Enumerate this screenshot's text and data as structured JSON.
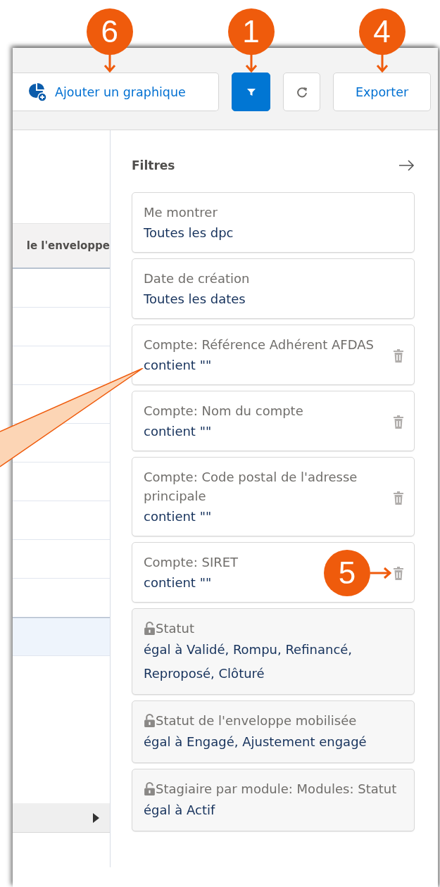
{
  "toolbar": {
    "buttons": [
      {
        "kind": "chart",
        "label": "Ajouter un graphique",
        "callout": "6"
      },
      {
        "kind": "filter",
        "selected": true,
        "callout": "1"
      },
      {
        "kind": "refresh"
      },
      {
        "kind": "text",
        "label": "Exporter",
        "callout": "4"
      }
    ]
  },
  "table": {
    "header": "le l'enveloppe",
    "rows": [
      {
        "selected": false
      },
      {
        "selected": false
      },
      {
        "selected": false
      },
      {
        "selected": false
      },
      {
        "selected": false
      },
      {
        "selected": false
      },
      {
        "selected": false
      },
      {
        "selected": false
      },
      {
        "selected": false
      },
      {
        "selected": true
      }
    ]
  },
  "filters": {
    "title": "Filtres",
    "items": [
      {
        "kind": "plain",
        "label": "Me montrer",
        "value": "Toutes les dpc"
      },
      {
        "kind": "plain",
        "label": "Date de création",
        "value": "Toutes les dates"
      },
      {
        "kind": "removable",
        "label": "Compte: Référence Adhérent AFDAS",
        "value": "contient \"\""
      },
      {
        "kind": "removable",
        "label": "Compte: Nom du compte",
        "value": "contient \"\""
      },
      {
        "kind": "removable",
        "label": "Compte: Code postal de l'adresse principale",
        "value": "contient \"\""
      },
      {
        "kind": "removable",
        "label": "Compte: SIRET",
        "value": "contient \"\"",
        "callout": "5"
      },
      {
        "kind": "locked",
        "label": "Statut",
        "value": "égal à Validé, Rompu, Refinancé, Reproposé, Clôturé"
      },
      {
        "kind": "locked",
        "label": "Statut de l'enveloppe mobilisée",
        "value": "égal à Engagé, Ajustement engagé"
      },
      {
        "kind": "locked",
        "label": "Stagiaire par module: Modules: Statut",
        "value": "égal à Actif"
      }
    ]
  }
}
